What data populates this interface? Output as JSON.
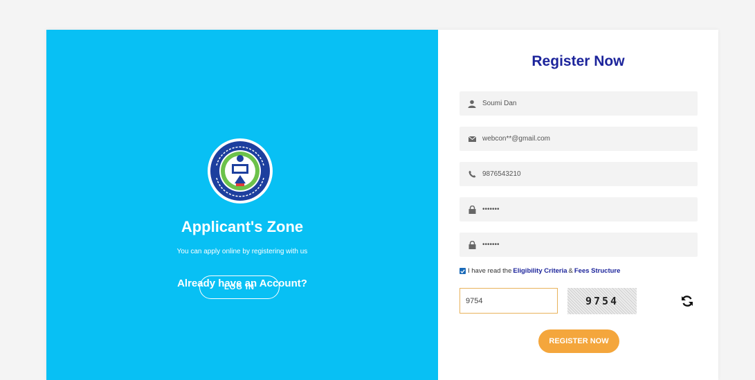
{
  "left_panel": {
    "title": "Applicant's Zone",
    "subtitle": "You can apply online by registering with us",
    "already_text": "Already have an Account?",
    "login_label": "LOG IN",
    "logo_name": "biswa-bangla-biswabidyalay-logo",
    "bg_color": "#08c0f4"
  },
  "register": {
    "title": "Register Now",
    "name_value": "Soumi Dan",
    "email_value": "webcon**@gmail.com",
    "phone_value": "9876543210",
    "password_value": "•••••••",
    "confirm_password_value": "•••••••",
    "checkbox_prefix": "I have read the",
    "eligibility_link": "Eligibility Criteria",
    "amp": "&",
    "fees_link": "Fees Structure",
    "captcha_input_value": "9754",
    "captcha_text": "9754",
    "submit_label": "REGISTER NOW",
    "title_color": "#1c249b",
    "button_color": "#f4a63c"
  },
  "icons": {
    "name": "user-icon",
    "email": "envelope-icon",
    "phone": "phone-icon",
    "password": "lock-icon",
    "refresh": "refresh-icon"
  }
}
